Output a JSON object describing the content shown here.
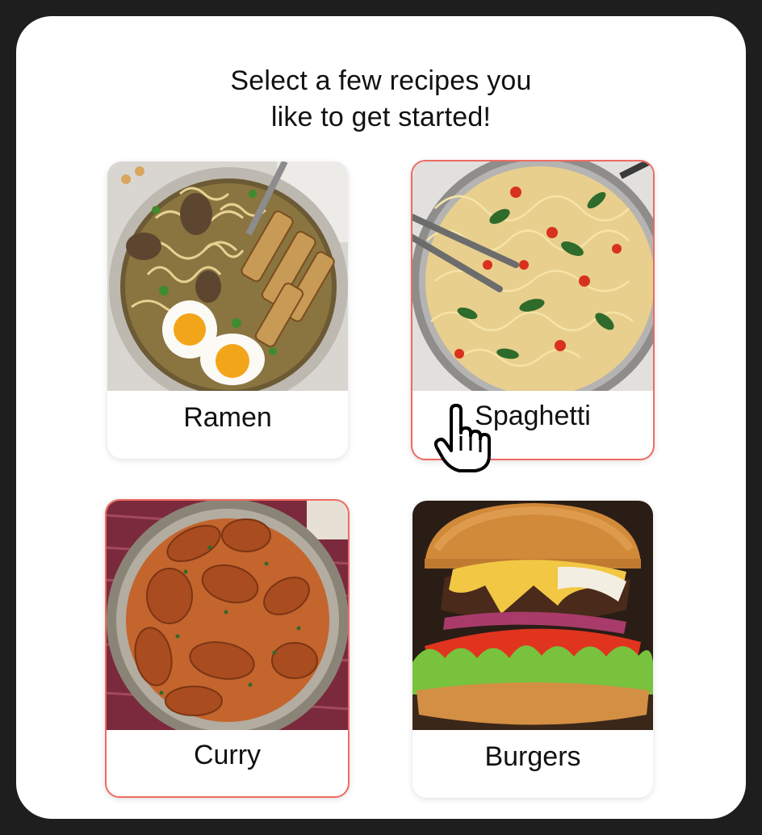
{
  "header": {
    "title_line1": "Select a few recipes you",
    "title_line2": "like to get started!"
  },
  "recipes": [
    {
      "label": "Ramen",
      "selected": false,
      "image_icon": "ramen-bowl-photo"
    },
    {
      "label": "Spaghetti",
      "selected": true,
      "image_icon": "spaghetti-pan-photo"
    },
    {
      "label": "Curry",
      "selected": true,
      "image_icon": "chicken-curry-photo"
    },
    {
      "label": "Burgers",
      "selected": false,
      "image_icon": "cheeseburger-photo"
    }
  ],
  "colors": {
    "selected_border": "#ee6b62",
    "page_background": "#1e1e1e",
    "panel_background": "#ffffff"
  },
  "cursor_icon": "hand-pointer-icon"
}
